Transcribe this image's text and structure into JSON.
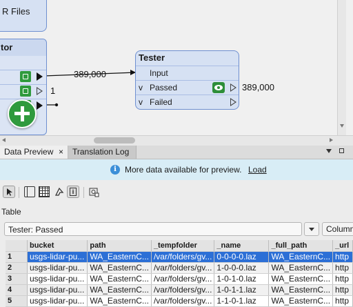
{
  "canvas": {
    "files_node_label": "R Files",
    "left_node_title": "tor",
    "left_port_count": "1",
    "wire_count": "389,000",
    "tester": {
      "title": "Tester",
      "ports": [
        {
          "name": "Input",
          "arrow": ""
        },
        {
          "name": "Passed",
          "arrow": "v"
        },
        {
          "name": "Failed",
          "arrow": "v"
        }
      ],
      "passed_count": "389,000"
    }
  },
  "tabs": [
    {
      "label": "Data Preview",
      "active": true
    },
    {
      "label": "Translation Log",
      "active": false
    }
  ],
  "info_bar": {
    "message": "More data available for preview.",
    "link": "Load"
  },
  "toolbar_icons": [
    "select-tool-icon",
    "panel-icon",
    "grid-icon",
    "style-icon",
    "info-icon",
    "camera-icon"
  ],
  "table_section": {
    "label": "Table",
    "selected_table": "Tester: Passed",
    "columns_button": "Column"
  },
  "table": {
    "columns": [
      "bucket",
      "path",
      "_tempfolder",
      "_name",
      "_full_path",
      "_url"
    ],
    "rows": [
      {
        "num": "1",
        "cells": [
          "usgs-lidar-pu...",
          "WA_EasternC...",
          "/var/folders/gv...",
          "0-0-0-0.laz",
          "WA_EasternC...",
          "http"
        ]
      },
      {
        "num": "2",
        "cells": [
          "usgs-lidar-pu...",
          "WA_EasternC...",
          "/var/folders/gv...",
          "1-0-0-0.laz",
          "WA_EasternC...",
          "http"
        ]
      },
      {
        "num": "3",
        "cells": [
          "usgs-lidar-pu...",
          "WA_EasternC...",
          "/var/folders/gv...",
          "1-0-1-0.laz",
          "WA_EasternC...",
          "http"
        ]
      },
      {
        "num": "4",
        "cells": [
          "usgs-lidar-pu...",
          "WA_EasternC...",
          "/var/folders/gv...",
          "1-0-1-1.laz",
          "WA_EasternC...",
          "http"
        ]
      },
      {
        "num": "5",
        "cells": [
          "usgs-lidar-pu...",
          "WA_EasternC...",
          "/var/folders/gv...",
          "1-1-0-1.laz",
          "WA_EasternC...",
          "http"
        ]
      }
    ]
  },
  "colors": {
    "node_fill": "#d6e1f3",
    "node_border": "#6e8fd0",
    "selection": "#2c6fd6",
    "info_bg": "#d8edf6",
    "add_button": "#2f9a3d"
  }
}
